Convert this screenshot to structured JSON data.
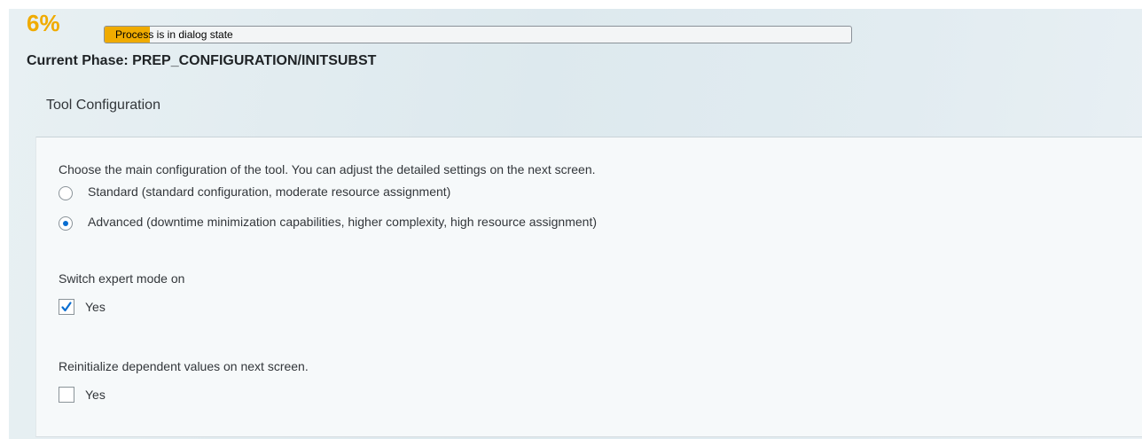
{
  "progress": {
    "percent_label": "6%",
    "fraction": 0.06,
    "status_text": "Process is in dialog state"
  },
  "phase": {
    "label": "Current Phase: PREP_CONFIGURATION/INITSUBST"
  },
  "section": {
    "title": "Tool Configuration"
  },
  "config": {
    "instruction": "Choose the main configuration of the tool. You can adjust the detailed settings on the next screen.",
    "options": [
      {
        "label": "Standard (standard configuration, moderate resource assignment)",
        "selected": false
      },
      {
        "label": "Advanced (downtime minimization capabilities, higher complexity, high resource assignment)",
        "selected": true
      }
    ]
  },
  "expert_mode": {
    "question": "Switch expert mode on",
    "checkbox_label": "Yes",
    "checked": true
  },
  "reinitialize": {
    "question": "Reinitialize dependent values on next screen.",
    "checkbox_label": "Yes",
    "checked": false
  },
  "colors": {
    "accent": "#f0ab00",
    "selection": "#0a6ed1"
  }
}
